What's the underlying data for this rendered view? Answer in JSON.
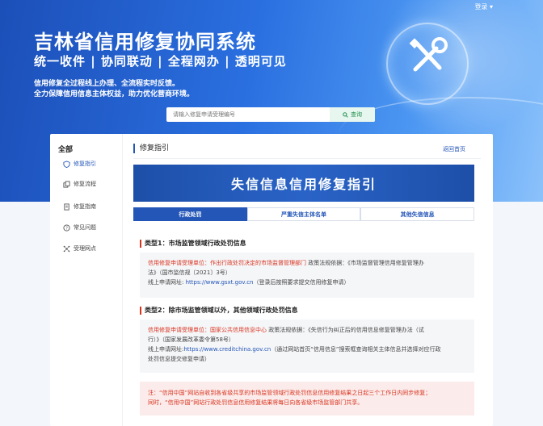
{
  "header": {
    "login": "登录",
    "title": "吉林省信用修复协同系统",
    "slogan": "统一收件 | 协同联动 | 全程网办 | 透明可见",
    "desc_line1": "信用修复全过程线上办理、全流程实时反馈。",
    "desc_line2": "全力保障信用信息主体权益，助力优化营商环境。"
  },
  "search": {
    "placeholder": "请输入修复申请受理编号",
    "button_label": "查询"
  },
  "sidebar": {
    "all_label": "全部",
    "items": [
      {
        "label": "修复指引",
        "icon": "shield-icon"
      },
      {
        "label": "修复流程",
        "icon": "copy-icon"
      },
      {
        "label": "修复指南",
        "icon": "document-icon"
      },
      {
        "label": "常见问题",
        "icon": "question-icon"
      },
      {
        "label": "受理网点",
        "icon": "network-icon"
      }
    ]
  },
  "main": {
    "section_title": "修复指引",
    "back_link": "返回首页",
    "banner_title": "失信信息信用修复指引",
    "tabs": [
      "行政处罚",
      "严重失信主体名单",
      "其他失信信息"
    ],
    "type1": {
      "title": "类型1：市场监管领域行政处罚信息",
      "line1_red": "信用修复申请受理单位：作出行政处罚决定的市场监督管理部门",
      "line1_rest": " 政策法规依据：《市场监督管理信用修复管理办",
      "line2": "法》（国市监信规〔2021〕3号）",
      "line3_prefix": "线上申请网址: ",
      "line3_link": "https://www.gsxt.gov.cn",
      "line3_suffix": "（登录后按照要求提交信用修复申请）"
    },
    "type2": {
      "title": "类型2：除市场监管领域以外，其他领域行政处罚信息",
      "line1_red": "信用修复申请受理单位：国家公共信用信息中心",
      "line1_rest": " 政策法规依据：《失信行为纠正后的信用信息修复管理办法（试",
      "line2": "行）》（国家发展改革委令第58号）",
      "line3_prefix": "线上申请网址:",
      "line3_link": "https://www.creditchina.gov.cn",
      "line3_suffix": "（通过网站首页“信用信息”搜索框查询相关主体信息并选择对应行政",
      "line4": "处罚信息提交修复申请）"
    },
    "note": {
      "line1": "注：“信用中国”网站自收到各省级共享的市场监管领域行政处罚信息信用修复结果之日起三个工作日内同步修复；",
      "line2": "同时，“信用中国”网站行政处罚信息信用修复结果将每日向各省级市场监管部门共享。"
    }
  },
  "colors": {
    "primary": "#2456b8",
    "accent_red": "#d9331f",
    "search_btn": "#1f8f4e"
  }
}
